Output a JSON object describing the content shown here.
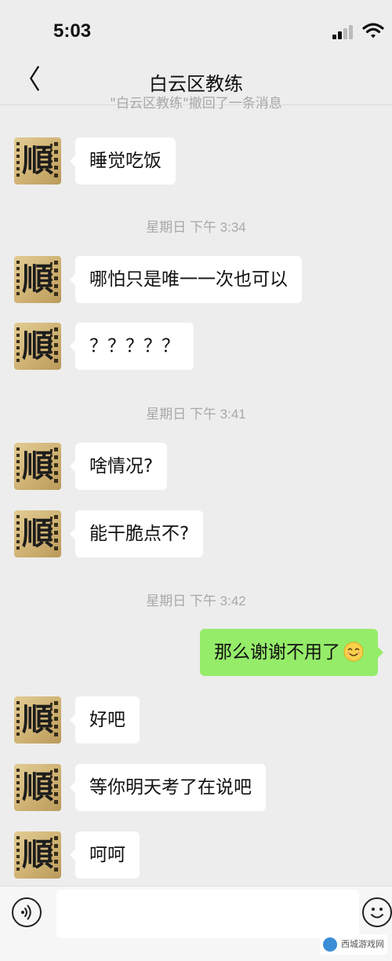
{
  "status": {
    "time": "5:03"
  },
  "nav": {
    "back_icon": "chevron-left-icon",
    "back_glyph": "〈",
    "title": "白云区教练"
  },
  "recall_notice": "\"白云区教练\"撤回了一条消息",
  "avatar": {
    "glyph": "順"
  },
  "messages": [
    {
      "text": "睡觉吃饭",
      "side": "in"
    },
    {
      "text": "哪怕只是唯一一次也可以",
      "side": "in"
    },
    {
      "text": "？？？？？",
      "side": "in"
    },
    {
      "text": "啥情况?",
      "side": "in"
    },
    {
      "text": "能干脆点不?",
      "side": "in"
    },
    {
      "text": "那么谢谢不用了",
      "side": "out",
      "emoji": "smile-emoji"
    },
    {
      "text": "好吧",
      "side": "in"
    },
    {
      "text": "等你明天考了在说吧",
      "side": "in"
    },
    {
      "text": "呵呵",
      "side": "in"
    }
  ],
  "timestamps": [
    "星期日 下午 3:34",
    "星期日 下午 3:41",
    "星期日 下午 3:42"
  ],
  "input_bar": {
    "voice_icon": "voice-icon",
    "emoji_icon": "emoji-icon"
  },
  "watermark": "西城游戏网",
  "colors": {
    "background": "#ededed",
    "incoming_bubble": "#ffffff",
    "outgoing_bubble": "#95ec69",
    "timestamp": "#a8a8a8"
  }
}
